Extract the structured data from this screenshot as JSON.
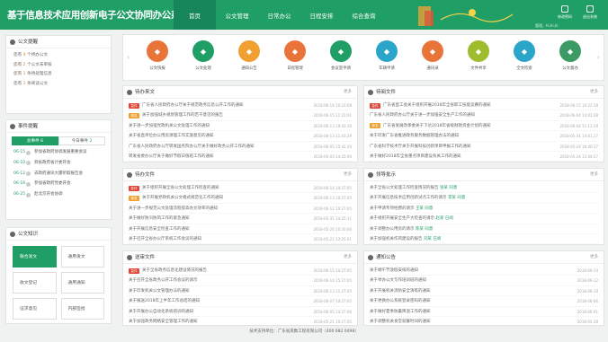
{
  "header": {
    "title": "基于信息技术应用创新电子公文协同办公系统",
    "nav": [
      "首页",
      "公文管理",
      "日常办公",
      "日程安排",
      "综合查询"
    ],
    "tools": [
      "修改密码",
      "退出系统"
    ],
    "user": "管理，hi,hi,hi"
  },
  "reminders": {
    "title": "公文提醒",
    "items": [
      {
        "pre": "您有",
        "n": "4",
        "post": "个待办公文"
      },
      {
        "pre": "您有",
        "n": "2",
        "post": "个公文未审核"
      },
      {
        "pre": "您有",
        "n": "1",
        "post": "条待处理信息"
      },
      {
        "pre": "您有",
        "n": "1",
        "post": "条阅读公文"
      }
    ]
  },
  "events": {
    "title": "事件提醒",
    "tabs": [
      {
        "label": "总事件",
        "count": "6"
      },
      {
        "label": "今日事件",
        "count": "2"
      }
    ],
    "items": [
      {
        "d": "06-15",
        "t": "参加省政府协调发展重要会议"
      },
      {
        "d": "06-10",
        "t": "到省政府省计委开会"
      },
      {
        "d": "06-12",
        "t": "去政府通讯大厦听取报告会"
      },
      {
        "d": "06-16",
        "t": "参加省政府党委开会"
      },
      {
        "d": "06-25",
        "t": "赴北京开会协调"
      }
    ]
  },
  "knowledge": {
    "title": "公文知识",
    "items": [
      "联合发文",
      "通用发文",
      "收文登记",
      "通用通知",
      "征求意见",
      "内部签批"
    ]
  },
  "icons": [
    {
      "l": "公文快报",
      "c": "#e9743a"
    },
    {
      "l": "公文处理",
      "c": "#1f9e66"
    },
    {
      "l": "通知公告",
      "c": "#f0a030"
    },
    {
      "l": "日程管理",
      "c": "#e9743a"
    },
    {
      "l": "会议室申请",
      "c": "#1f9e66"
    },
    {
      "l": "车辆申请",
      "c": "#2ba5c8"
    },
    {
      "l": "通讯录",
      "c": "#e9743a"
    },
    {
      "l": "文件共享",
      "c": "#9fbc2c"
    },
    {
      "l": "全文检索",
      "c": "#2ba5c8"
    },
    {
      "l": "公文督办",
      "c": "#3c9b65"
    }
  ],
  "todo": {
    "title": "待办来文",
    "more": "更多",
    "rows": [
      {
        "b": "急件",
        "bc": "#e2463a",
        "t": "广东省人民政府办公厅关于规范政务信息公开工作的通知",
        "d": "2018-06-14 10:22:08"
      },
      {
        "b": "紧急",
        "bc": "#f0a030",
        "t": "关于加强城乡规划管理工作的若干意见的报告",
        "d": "2018-06-15 11:22:01"
      },
      {
        "b": "",
        "bc": "",
        "t": "关于进一步加强党政机关公文处理工作的通知",
        "d": "2018-06-13 16:43:10"
      },
      {
        "b": "",
        "bc": "",
        "t": "关于省直单位办公用房清理工作实施意见的通知",
        "d": "2018-06-13 11:43:29"
      },
      {
        "b": "",
        "bc": "",
        "t": "广东省人民政府办公厅转发国务院办公厅关于做好政务公开工作的通知",
        "d": "2018-06-05 15:42:20"
      },
      {
        "b": "",
        "bc": "",
        "t": "转发省委办公厅关于做好节假日值班工作的通知",
        "d": "2018-05-03 14:25:00"
      }
    ]
  },
  "pending": {
    "title": "待阅文件",
    "more": "更多",
    "rows": [
      {
        "b": "急件",
        "bc": "#e2463a",
        "t": "广东省直工会关于组织开展2018年全省职工技能竞赛的通知",
        "d": "2018-06-15 10:22:28"
      },
      {
        "b": "",
        "bc": "",
        "t": "广东省人民政府办公厅关于进一步加强安全生产工作的通知",
        "d": "2018-06-04 14:02:28"
      },
      {
        "b": "紧急",
        "bc": "#f0a030",
        "t": "广东省发展改革委关于下达2018年省级财政资金计划的通知",
        "d": "2018-06-04 11:12:28"
      },
      {
        "b": "",
        "bc": "",
        "t": "关于印发广东省推进政务服务数据管理办法的通知",
        "d": "2018-05-31 14:01:17"
      },
      {
        "b": "",
        "bc": "",
        "t": "广东省科学技术厅关于开展科技创新项目申报工作的通知",
        "d": "2018-05-24 16:00:17"
      },
      {
        "b": "",
        "bc": "",
        "t": "关于做好2018年全省重点项目建设有关工作的通知",
        "d": "2018-05-24 11:00:27"
      }
    ]
  },
  "pendingDoc": {
    "title": "待办文件",
    "more": "更多",
    "rows": [
      {
        "b": "急件",
        "bc": "#e2463a",
        "t": "关于组织开展全省公文处理工作检查的通知",
        "d": "2018-06-14 10:27:05"
      },
      {
        "b": "紧急",
        "bc": "#f0a030",
        "t": "关于开展党政机关公文格式规范化工作的通知",
        "d": "2018-06-13 10:27:05"
      },
      {
        "b": "",
        "bc": "",
        "t": "关于进一步规范公文处理流程提高办文效率的通知",
        "d": "2018-06-12 10:27:05"
      },
      {
        "b": "",
        "bc": "",
        "t": "关于做好防汛防风工作的紧急通知",
        "d": "2018-05-31 14:25:11"
      },
      {
        "b": "",
        "bc": "",
        "t": "关于开展信息安全检查工作的通知",
        "d": "2018-05-26 10:20:06"
      },
      {
        "b": "",
        "bc": "",
        "t": "关于召开全省办公厅系统工作会议的通知",
        "d": "2018-05-21 13:25:01"
      }
    ]
  },
  "leader": {
    "title": "领导批示",
    "more": "更多",
    "rows": [
      {
        "t": "关于全省公文处理工作检查情况的报告",
        "who": "张某 同意",
        "d": ""
      },
      {
        "t": "关于开展信息技术应用创新试点工作的请示",
        "who": "李某 同意",
        "d": ""
      },
      {
        "t": "关于申请专项经费的请示",
        "who": "王某 同意",
        "d": ""
      },
      {
        "t": "关于组织开展安全生产大检查的请示",
        "who": "赵某 已阅",
        "d": ""
      },
      {
        "t": "关于调整办公用房的请示",
        "who": "陈某 同意",
        "d": ""
      },
      {
        "t": "关于加强机关作风建设的报告",
        "who": "刘某 已阅",
        "d": ""
      }
    ]
  },
  "sent": {
    "title": "送审文件",
    "more": "更多",
    "rows": [
      {
        "b": "急件",
        "bc": "#e2463a",
        "t": "关于全省政务信息化建设情况的报告",
        "d": "2018-06-15 10:27:05"
      },
      {
        "b": "",
        "bc": "",
        "t": "关于召开全省政务公开工作会议的请示",
        "d": "2018-06-14 15:27:05"
      },
      {
        "b": "",
        "bc": "",
        "t": "关于印发机关公文管理办法的通知",
        "d": "2018-06-13 11:27:05"
      },
      {
        "b": "",
        "bc": "",
        "t": "关于报送2018年上半年工作总结的通知",
        "d": "2018-06-07 10:27:05"
      },
      {
        "b": "",
        "bc": "",
        "t": "关于开展办公自动化系统培训的通知",
        "d": "2018-06-05 14:27:06"
      },
      {
        "b": "",
        "bc": "",
        "t": "关于加强政务网络安全管理工作的通知",
        "d": "2018-05-21 10:27:05"
      }
    ]
  },
  "notice": {
    "title": "通知公告",
    "more": "更多",
    "rows": [
      {
        "t": "关于端午节放假安排的通知",
        "d": "2018-06-14"
      },
      {
        "t": "关于举办公文写作培训班的通知",
        "d": "2018-06-12"
      },
      {
        "t": "关于开展机关消防安全演练的通知",
        "d": "2018-06-10"
      },
      {
        "t": "关于更换办公系统登录密码的通知",
        "d": "2018-06-06"
      },
      {
        "t": "关于做好夏季防暑降温工作的通知",
        "d": "2018-06-01"
      },
      {
        "t": "关于调整机关食堂就餐时间的通知",
        "d": "2018-05-28"
      }
    ]
  },
  "footer": "技术支持单位：广东省岚数工程有限公司（400 682 0498）"
}
